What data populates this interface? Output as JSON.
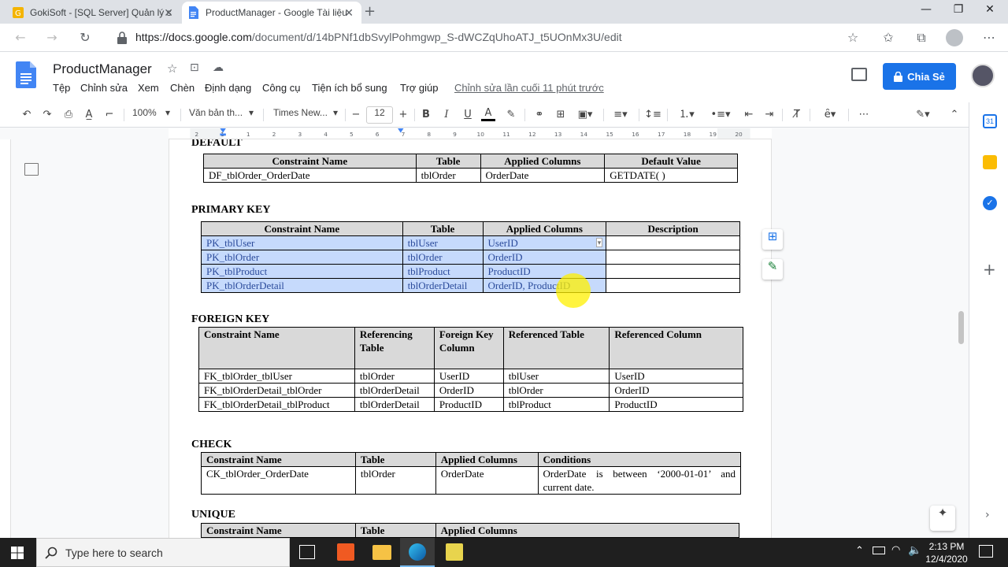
{
  "browser": {
    "tabs": [
      {
        "title": "GokiSoft - [SQL Server] Quản lý s"
      },
      {
        "title": "ProductManager - Google Tài liệu"
      }
    ],
    "url_host": "https://docs.google.com",
    "url_path": "/document/d/14bPNf1dbSvylPohmgwp_S-dWCZqUhoATJ_t5UOnMx3U/edit"
  },
  "docs": {
    "title": "ProductManager",
    "menu": [
      "Tệp",
      "Chỉnh sửa",
      "Xem",
      "Chèn",
      "Định dạng",
      "Công cụ",
      "Tiện ích bổ sung",
      "Trợ giúp"
    ],
    "last_edit": "Chỉnh sửa lần cuối 11 phút trước",
    "share_label": "Chia Sẻ"
  },
  "toolbar": {
    "zoom": "100%",
    "style": "Văn bản th...",
    "font": "Times New...",
    "font_size": "12"
  },
  "ruler": {
    "labels": [
      "2",
      "1",
      "1",
      "2",
      "3",
      "4",
      "5",
      "6",
      "7",
      "8",
      "9",
      "10",
      "11",
      "12",
      "13",
      "14",
      "15",
      "16",
      "17",
      "18",
      "19",
      "20"
    ]
  },
  "content": {
    "default": {
      "heading": "DEFAULT",
      "headers": [
        "Constraint Name",
        "Table",
        "Applied Columns",
        "Default Value"
      ],
      "rows": [
        [
          "DF_tblOrder_OrderDate",
          "tblOrder",
          "OrderDate",
          "GETDATE( )"
        ]
      ]
    },
    "primary": {
      "heading": "PRIMARY KEY",
      "headers": [
        "Constraint Name",
        "Table",
        "Applied Columns",
        "Description"
      ],
      "rows": [
        [
          "PK_tblUser",
          "tblUser",
          "UserID",
          ""
        ],
        [
          "PK_tblOrder",
          "tblOrder",
          "OrderID",
          ""
        ],
        [
          "PK_tblProduct",
          "tblProduct",
          "ProductID",
          ""
        ],
        [
          "PK_tblOrderDetail",
          "tblOrderDetail",
          "OrderID, ProductID",
          ""
        ]
      ]
    },
    "foreign": {
      "heading": "FOREIGN KEY",
      "headers": [
        "Constraint Name",
        "Referencing Table",
        "Foreign Key Column",
        "Referenced Table",
        "Referenced Column"
      ],
      "rows": [
        [
          "FK_tblOrder_tblUser",
          "tblOrder",
          "UserID",
          "tblUser",
          "UserID"
        ],
        [
          "FK_tblOrderDetail_tblOrder",
          "tblOrderDetail",
          "OrderID",
          "tblOrder",
          "OrderID"
        ],
        [
          "FK_tblOrderDetail_tblProduct",
          "tblOrderDetail",
          "ProductID",
          "tblProduct",
          "ProductID"
        ]
      ]
    },
    "check": {
      "heading": "CHECK",
      "headers": [
        "Constraint Name",
        "Table",
        "Applied Columns",
        "Conditions"
      ],
      "rows": [
        [
          "CK_tblOrder_OrderDate",
          "tblOrder",
          "OrderDate",
          "OrderDate is between ‘2000-01-01’ and current date."
        ]
      ]
    },
    "unique": {
      "heading": "UNIQUE",
      "headers": [
        "Constraint Name",
        "Table",
        "Applied Columns"
      ]
    }
  },
  "taskbar": {
    "search_placeholder": "Type here to search",
    "time": "2:13 PM",
    "date": "12/4/2020"
  }
}
